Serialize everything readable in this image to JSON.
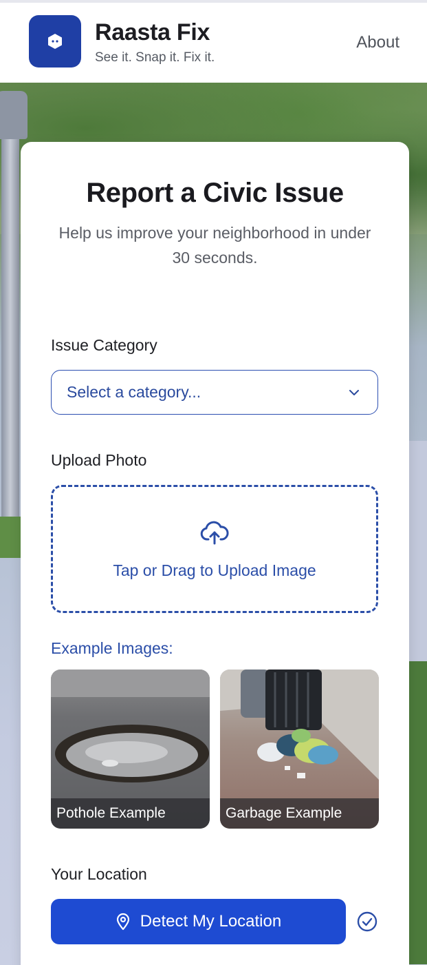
{
  "header": {
    "brand_title": "Raasta Fix",
    "brand_tagline": "See it. Snap it. Fix it.",
    "nav_about": "About"
  },
  "form": {
    "title": "Report a Civic Issue",
    "subtitle": "Help us improve your neighborhood in under 30 seconds.",
    "category_label": "Issue Category",
    "category_value": "Select a category...",
    "photo_label": "Upload Photo",
    "upload_text": "Tap or Drag to Upload Image",
    "examples_label": "Example Images:",
    "examples": [
      {
        "caption": "Pothole Example"
      },
      {
        "caption": "Garbage Example"
      }
    ],
    "location_label": "Your Location",
    "location_button": "Detect My Location"
  },
  "colors": {
    "brand": "#1f3fa5",
    "accent": "#2b4ea8",
    "button": "#1e4bd2"
  },
  "icons": {
    "logo": "hexagon-icon",
    "dropdown": "chevron-down-icon",
    "upload": "cloud-upload-icon",
    "location": "map-pin-icon",
    "status": "check-circle-icon"
  }
}
